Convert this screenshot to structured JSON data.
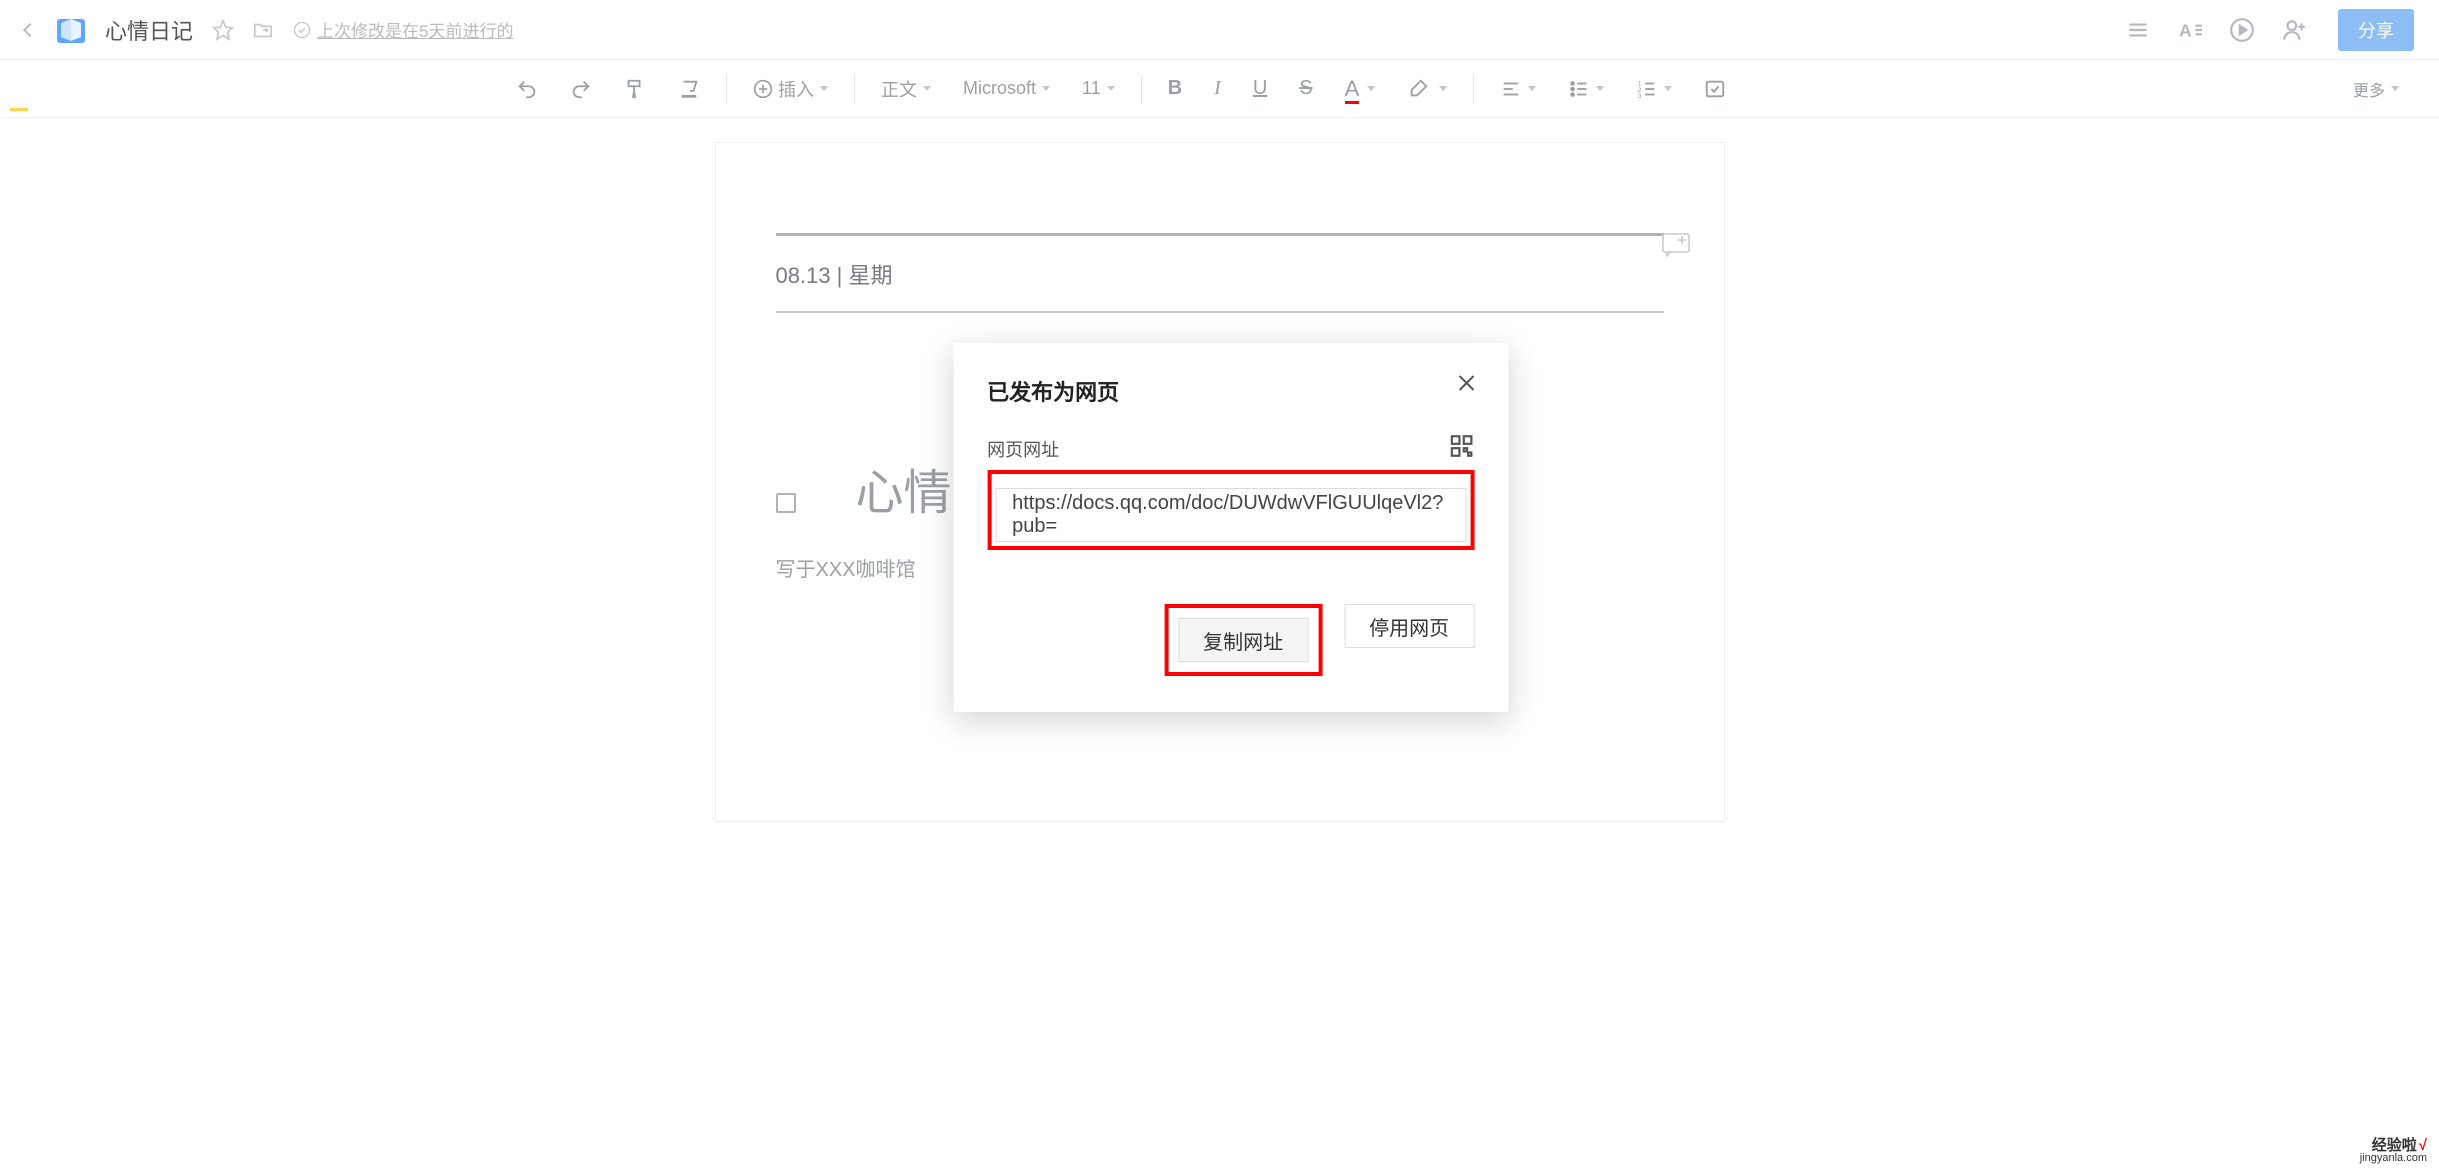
{
  "header": {
    "doc_title": "心情日记",
    "status_text": "上次修改是在5天前进行的",
    "share_label": "分享"
  },
  "toolbar": {
    "insert": "插入",
    "para_style": "正文",
    "font_name": "Microsoft",
    "font_size": "11",
    "more": "更多"
  },
  "document": {
    "date_meta_prefix": "08.13 | 星期",
    "heading": "心情日记",
    "subtitle": "写于XXX咖啡馆"
  },
  "dialog": {
    "title": "已发布为网页",
    "url_label": "网页网址",
    "url_value": "https://docs.qq.com/doc/DUWdwVFlGUUlqeVl2?pub=",
    "copy_btn": "复制网址",
    "disable_btn": "停用网页"
  },
  "watermark": {
    "brand": "经验啦",
    "check": "√",
    "domain": "jingyanla.com"
  }
}
